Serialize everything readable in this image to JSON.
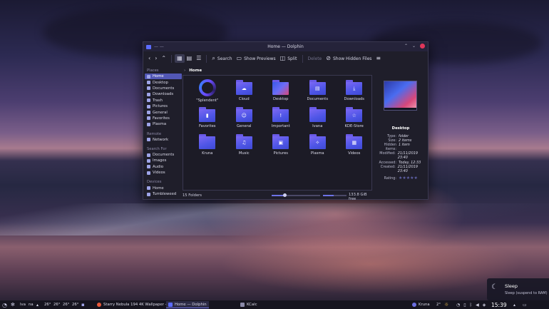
{
  "window": {
    "title": "Home — Dolphin"
  },
  "toolbar": {
    "search": "Search",
    "show_previews": "Show Previews",
    "split": "Split",
    "delete": "Delete",
    "show_hidden": "Show Hidden Files"
  },
  "sidebar": {
    "places_title": "Places",
    "places": [
      "Home",
      "Desktop",
      "Documents",
      "Downloads",
      "Trash",
      "Pictures",
      "General",
      "Favorites",
      "Plasma"
    ],
    "remote_title": "Remote",
    "remote": [
      "Network"
    ],
    "search_title": "Search For",
    "search": [
      "Documents",
      "Images",
      "Audio",
      "Videos"
    ],
    "devices_title": "Devices",
    "devices": [
      "Home",
      "Tumbleweed"
    ]
  },
  "breadcrumb": {
    "current": "Home"
  },
  "folders": [
    {
      "name": "\"Splendent\"",
      "icon": "splendent-logo-icon",
      "glyph": ""
    },
    {
      "name": "Cloud",
      "icon": "cloud-icon",
      "glyph": "☁"
    },
    {
      "name": "Desktop",
      "icon": "desktop-icon",
      "glyph": ""
    },
    {
      "name": "Documents",
      "icon": "document-icon",
      "glyph": "▤"
    },
    {
      "name": "Downloads",
      "icon": "download-icon",
      "glyph": "⤓"
    },
    {
      "name": "Favorites",
      "icon": "bookmark-icon",
      "glyph": "▮"
    },
    {
      "name": "General",
      "icon": "users-icon",
      "glyph": "☺"
    },
    {
      "name": "Important",
      "icon": "exclamation-icon",
      "glyph": "!"
    },
    {
      "name": "Ivana",
      "icon": "folder-icon",
      "glyph": ""
    },
    {
      "name": "KDE-Store",
      "icon": "star-icon",
      "glyph": "☆"
    },
    {
      "name": "Kruna",
      "icon": "folder-icon",
      "glyph": ""
    },
    {
      "name": "Music",
      "icon": "music-icon",
      "glyph": "♫"
    },
    {
      "name": "Pictures",
      "icon": "image-icon",
      "glyph": "▣"
    },
    {
      "name": "Plasma",
      "icon": "plasma-icon",
      "glyph": "✧"
    },
    {
      "name": "Videos",
      "icon": "film-icon",
      "glyph": "▦"
    }
  ],
  "status": {
    "count": "15 Folders",
    "free": "133.8 GiB free",
    "zoom_level": 0.26,
    "space_used": 0.45
  },
  "info": {
    "name": "Desktop",
    "rows": [
      {
        "k": "Type:",
        "v": "folder"
      },
      {
        "k": "Size:",
        "v": "2 items"
      },
      {
        "k": "Hidden items:",
        "v": "1 item"
      },
      {
        "k": "Modified:",
        "v": "21/11/2019 23:40"
      },
      {
        "k": "Accessed:",
        "v": "Today, 12:33"
      },
      {
        "k": "Created:",
        "v": "21/11/2019 23:40"
      }
    ],
    "rating_label": "Rating:",
    "rating": "★★★★★"
  },
  "notification": {
    "title": "Sleep",
    "body": "Sleep (suspend to RAM)"
  },
  "panel": {
    "user": "Iva",
    "na": "na",
    "temps": [
      "26°",
      "26°",
      "26°",
      "26°"
    ],
    "tasks": [
      "Starry Nebula 194 4K Wallpaper - p...",
      "Home — Dolphin",
      "KCalc",
      "Kruna"
    ],
    "weather": "2°",
    "clock": "15:39"
  },
  "colors": {
    "accent": "#5257b5",
    "folder": "#5c5ee8",
    "close": "#e0365a"
  }
}
